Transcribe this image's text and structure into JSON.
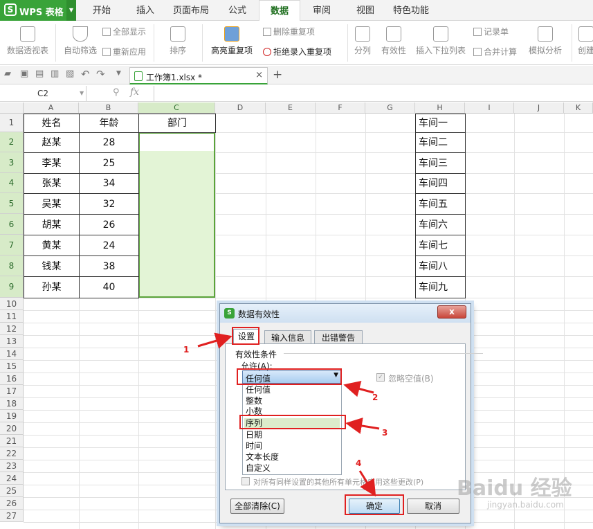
{
  "app": {
    "logo_letter": "S",
    "title": "WPS 表格",
    "dropdown_glyph": "▼"
  },
  "ribbon_tabs": [
    "开始",
    "插入",
    "页面布局",
    "公式",
    "数据",
    "审阅",
    "视图",
    "特色功能"
  ],
  "active_tab": "数据",
  "toolbar": {
    "pivot": "数据透视表",
    "autofilter": "自动筛选",
    "show_all": "全部显示",
    "reapply": "重新应用",
    "sort": "排序",
    "highlight_dup": "高亮重复项",
    "remove_dup": "删除重复项",
    "reject_dup": "拒绝录入重复项",
    "split": "分列",
    "validity": "有效性",
    "insert_dropdown": "插入下拉列表",
    "record_form": "记录单",
    "consolidate": "合并计算",
    "what_if": "模拟分析",
    "create": "创建"
  },
  "file_tab": {
    "name": "工作簿1.xlsx *",
    "close": "×",
    "new": "+"
  },
  "formula_bar": {
    "cell_ref": "C2",
    "fx": "fx"
  },
  "sheet": {
    "columns": [
      "A",
      "B",
      "C",
      "D",
      "E",
      "F",
      "G",
      "H",
      "I",
      "J",
      "K"
    ],
    "rows": [
      "1",
      "2",
      "3",
      "4",
      "5",
      "6",
      "7",
      "8",
      "9",
      "10",
      "11",
      "12",
      "13",
      "14",
      "15",
      "16",
      "17",
      "18",
      "19",
      "20",
      "21",
      "22",
      "23",
      "24",
      "25",
      "26",
      "27"
    ],
    "headers": [
      "姓名",
      "年龄",
      "部门"
    ],
    "names": [
      "赵某",
      "李某",
      "张某",
      "吴某",
      "胡某",
      "黄某",
      "钱某",
      "孙某"
    ],
    "ages": [
      "28",
      "25",
      "34",
      "32",
      "26",
      "24",
      "38",
      "40"
    ],
    "workshops": [
      "车间一",
      "车间二",
      "车间三",
      "车间四",
      "车间五",
      "车间六",
      "车间七",
      "车间八",
      "车间九"
    ]
  },
  "dialog": {
    "title": "数据有效性",
    "close": "x",
    "tabs": [
      "设置",
      "输入信息",
      "出错警告"
    ],
    "group_label": "有效性条件",
    "allow_label": "允许(A):",
    "selected": "任何值",
    "options": [
      "任何值",
      "整数",
      "小数",
      "序列",
      "日期",
      "时间",
      "文本长度",
      "自定义"
    ],
    "ignore_blank": "忽略空值(B)",
    "apply_all": "对所有同样设置的其他所有单元格应用这些更改(P)",
    "clear_all": "全部清除(C)",
    "ok": "确定",
    "cancel": "取消"
  },
  "annotations": [
    "1",
    "2",
    "3",
    "4"
  ],
  "watermark": {
    "main": "Baidu 经验",
    "sub": "jingyan.baidu.com"
  },
  "colors": {
    "brand_green": "#39a339",
    "selection_fill": "#e3f4d6",
    "annotation_red": "#e02020"
  }
}
